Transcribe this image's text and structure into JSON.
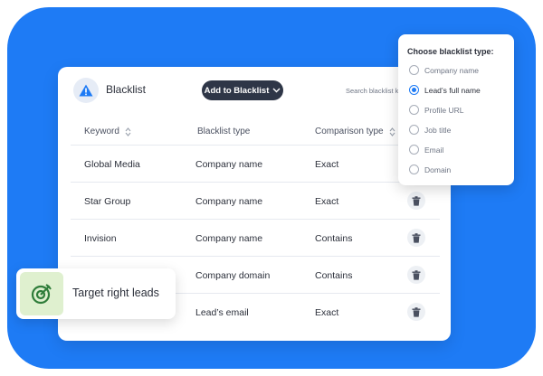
{
  "header": {
    "title": "Blacklist",
    "add_button": "Add to Blacklist",
    "search_placeholder": "Search blacklist ke"
  },
  "table": {
    "columns": [
      "Keyword",
      "Blacklist type",
      "Comparison type"
    ],
    "rows": [
      {
        "keyword": "Global Media",
        "type": "Company name",
        "comparison": "Exact"
      },
      {
        "keyword": "Star Group",
        "type": "Company name",
        "comparison": "Exact"
      },
      {
        "keyword": "Invision",
        "type": "Company name",
        "comparison": "Contains"
      },
      {
        "keyword": "",
        "type": "Company domain",
        "comparison": "Contains"
      },
      {
        "keyword": "",
        "type": "Lead’s email",
        "comparison": "Exact"
      }
    ]
  },
  "popup": {
    "title": "Choose blacklist type:",
    "options": [
      "Company name",
      "Lead’s full name",
      "Profile URL",
      "Job title",
      "Email",
      "Domain"
    ],
    "selected": "Lead’s full name"
  },
  "badge": {
    "label": "Target right leads"
  },
  "colors": {
    "brand_blue": "#1e7bf5",
    "button_dark": "#2e3647",
    "badge_green": "#dff0cf",
    "icon_green": "#2f7d3a"
  },
  "icons": [
    "warning-icon",
    "chevron-down-icon",
    "sort-icon",
    "trash-icon",
    "target-icon"
  ]
}
